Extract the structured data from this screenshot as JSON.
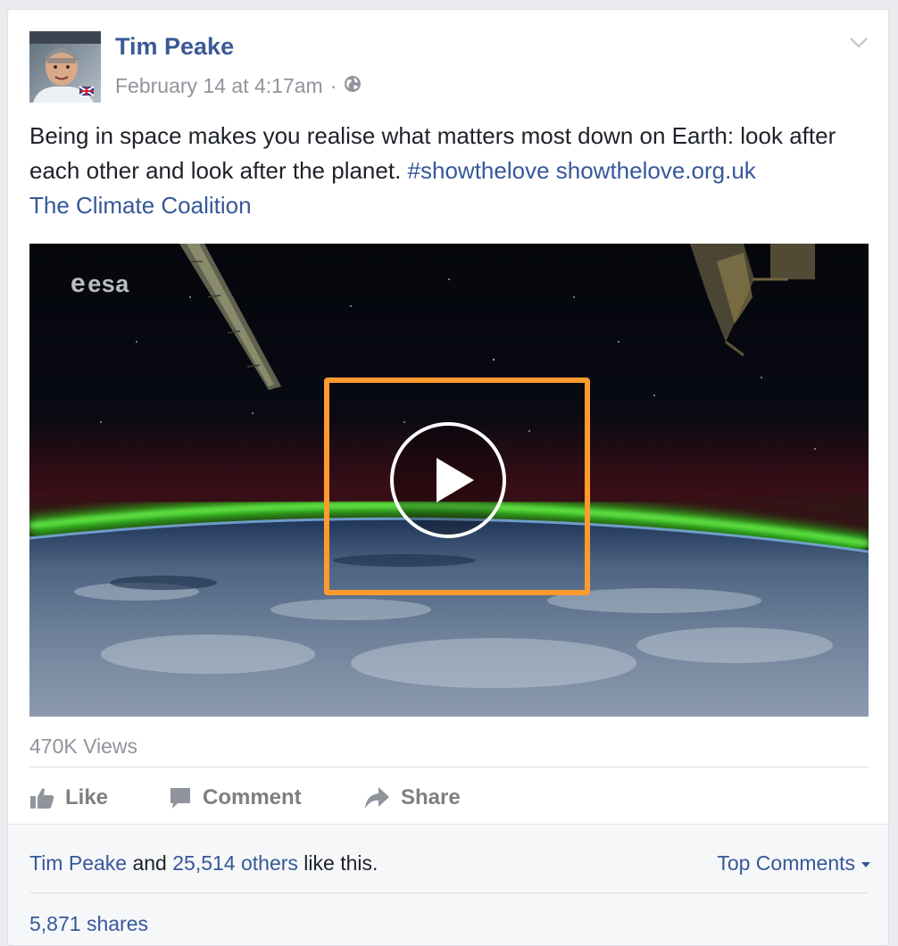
{
  "post": {
    "author": "Tim Peake",
    "timestamp": "February 14 at 4:17am",
    "separator": "·",
    "privacy_icon": "globe-icon",
    "menu_icon": "chevron-down-icon",
    "text_main": "Being in space makes you realise what matters most down on Earth: look after each other and look after the planet.",
    "hashtag": "#showthelove",
    "link": "showthelove.org.uk",
    "tagged_page": "The Climate Coalition"
  },
  "video": {
    "watermark": "esa",
    "play_icon": "play-icon",
    "highlight_color": "#ff9a2f",
    "views": "470K Views"
  },
  "actions": {
    "like": "Like",
    "comment": "Comment",
    "share": "Share"
  },
  "footer": {
    "liker_name": "Tim Peake",
    "and": "and",
    "others_count": "25,514 others",
    "like_suffix": "like this.",
    "top_comments": "Top Comments",
    "shares": "5,871 shares"
  },
  "colors": {
    "link": "#365899",
    "name": "#3b5998",
    "muted": "#90949c",
    "text": "#1d2129"
  }
}
